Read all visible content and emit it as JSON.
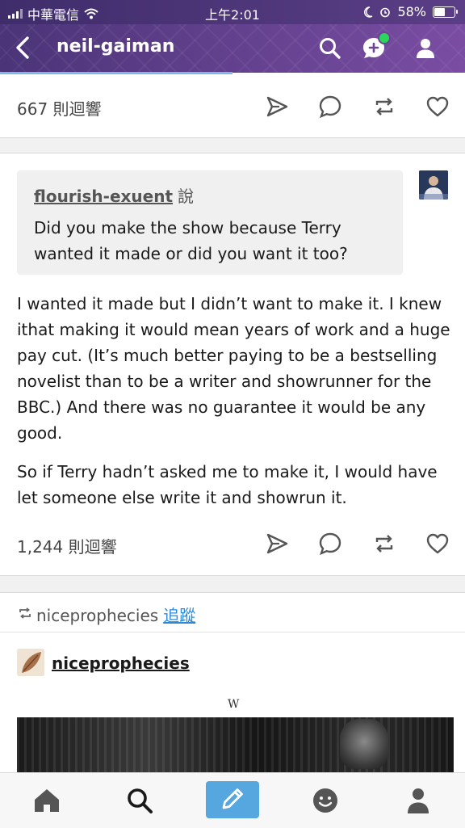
{
  "status_bar": {
    "carrier": "中華電信",
    "time": "上午2:01",
    "battery": "58%",
    "battery_level": 0.58
  },
  "app_bar": {
    "title": "neil-gaiman",
    "icons": [
      "back-chevron-icon",
      "search-icon",
      "new-message-icon",
      "account-icon"
    ],
    "accent": "#7a4da3"
  },
  "post1": {
    "notes_count": "667 則迴響"
  },
  "post2": {
    "quote_user": "flourish-exuent",
    "quote_suffix": "說",
    "quote_text": "Did you make the show because Terry wanted it made or did you want it too?",
    "paragraphs": [
      "I wanted it made but I didn’t want to make it. I knew ithat making it would mean years of work and a huge pay cut. (It’s much better paying to be a bestselling novelist than to be a writer and showrunner for the BBC.) And there was no guarantee it would be any good.",
      "So if Terry hadn’t asked me to make it, I would have let someone else write it and showrun it."
    ],
    "notes_count": "1,244 則迴響"
  },
  "post3": {
    "reblogged_from": "niceprophecies",
    "follow_label": "追蹤",
    "poster": "niceprophecies",
    "watermark": "W"
  },
  "actions": [
    "share-icon",
    "reply-icon",
    "reblog-icon",
    "like-icon"
  ],
  "tab_bar": {
    "items": [
      "home-icon",
      "search-icon",
      "compose-icon",
      "activity-icon",
      "account-icon"
    ],
    "compose_color": "#56a7df"
  }
}
